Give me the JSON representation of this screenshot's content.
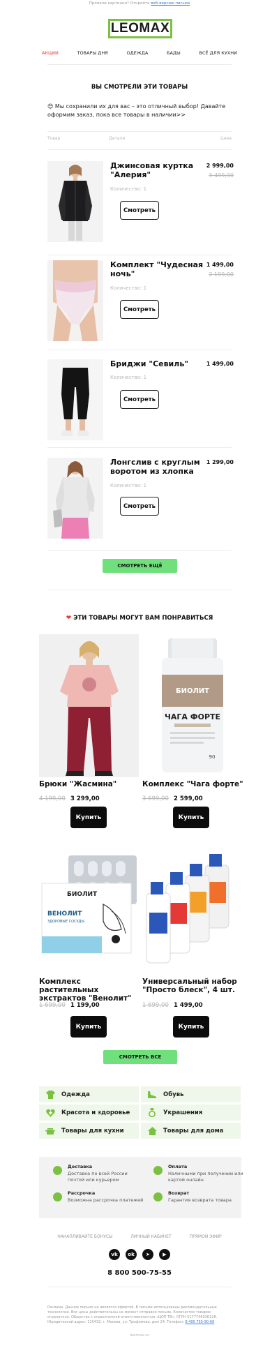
{
  "preheader": {
    "text": "Пропали картинки? Откройте",
    "link": "веб-версию письма"
  },
  "logo": "LEOMAX",
  "nav": [
    "АКЦИИ",
    "ТОВАРЫ ДНЯ",
    "ОДЕЖДА",
    "БАДЫ",
    "ВСЁ ДЛЯ КУХНИ"
  ],
  "viewed": {
    "title": "ВЫ СМОТРЕЛИ ЭТИ ТОВАРЫ",
    "intro": "😍 Мы сохранили их для вас – это отличный выбор! Давайте оформим заказ, пока все товары в наличии>>",
    "headers": {
      "item": "Товар",
      "details": "Детали",
      "price": "Цена"
    },
    "qty_label": "Количество: 1",
    "button": "Смотреть",
    "products": [
      {
        "name": "Джинсовая куртка \"Алерия\"",
        "price": "2 999,00",
        "old_price": "3 499,00"
      },
      {
        "name": "Комплект \"Чудесная ночь\"",
        "price": "1 499,00",
        "old_price": "2 199,00"
      },
      {
        "name": "Бриджи \"Севиль\"",
        "price": "1 499,00",
        "old_price": ""
      },
      {
        "name": "Лонгслив с круглым воротом из хлопка",
        "price": "1 299,00",
        "old_price": ""
      }
    ],
    "more_button": "СМОТРЕТЬ ЕЩЁ"
  },
  "recommend": {
    "title": "ЭТИ ТОВАРЫ МОГУТ ВАМ ПОНРАВИТЬСЯ",
    "title_icon": "heart-icon",
    "button": "Купить",
    "items": [
      {
        "name": "Брюки \"Жасмина\"",
        "old_price": "4 199,00",
        "price": "3 299,00"
      },
      {
        "name": "Комплекс \"Чага форте\"",
        "old_price": "3 699,00",
        "price": "2 599,00"
      },
      {
        "name": "Комплекс растительных экстрактов \"Венолит\"",
        "old_price": "1 699,00",
        "price": "1 199,00"
      },
      {
        "name": "Универсальный набор \"Просто блеск\", 4 шт.",
        "old_price": "1 699,00",
        "price": "1 499,00"
      }
    ],
    "all_button": "СМОТРЕТЬ ВСЕ",
    "product_labels": {
      "chaga_brand": "БИОЛИТ",
      "chaga_title": "ЧАГА ФОРТЕ",
      "chaga_count": "90",
      "venolit_brand": "БИОЛИТ",
      "venolit_title": "ВЕНОЛИТ",
      "venolit_sub": "ЗДОРОВЫЕ СОСУДЫ"
    }
  },
  "categories": [
    {
      "label": "Одежда",
      "icon": "shirt-icon"
    },
    {
      "label": "Обувь",
      "icon": "shoe-icon"
    },
    {
      "label": "Красота и здоровье",
      "icon": "heart-plus-icon"
    },
    {
      "label": "Украшения",
      "icon": "ring-icon"
    },
    {
      "label": "Товары для кухни",
      "icon": "pot-icon"
    },
    {
      "label": "Товары для дома",
      "icon": "house-icon"
    }
  ],
  "info": [
    {
      "title": "Доставка",
      "text": "Доставка по всей России почтой или курьером",
      "icon": "box-icon"
    },
    {
      "title": "Оплата",
      "text": "Наличными при получении или картой онлайн",
      "icon": "ruble-icon"
    },
    {
      "title": "Рассрочка",
      "text": "Возможна рассрочка платежей",
      "icon": "clock-icon"
    },
    {
      "title": "Возврат",
      "text": "Гарантия возврата товара",
      "icon": "return-icon"
    }
  ],
  "footer_links": [
    "НАКАПЛИВАЙТЕ БОНУСЫ",
    "ЛИЧНЫЙ КАБИНЕТ",
    "ПРЯМОЙ ЭФИР"
  ],
  "socials": [
    {
      "name": "vk-icon",
      "glyph": "vk"
    },
    {
      "name": "ok-icon",
      "glyph": "ok"
    },
    {
      "name": "telegram-icon",
      "glyph": "➤"
    },
    {
      "name": "youtube-icon",
      "glyph": "▶"
    }
  ],
  "phone": "8 800 500-75-55",
  "legal": {
    "text": "Реклама. Данное письмо не является офертой. В письме использованы рекомендательные технологии. Все цены действительны на момент отправки письма. Количество товаров ограничено. Общество с ограниченной ответственностью «ЦОП ТВ», ОГРН 5177746036128. Юридический адрес: 115432, г. Москва, ул. Трофимова, дом 24. Телефон:",
    "phone": "8 495 755-90-60"
  },
  "footer_domain": "leomax.ru"
}
